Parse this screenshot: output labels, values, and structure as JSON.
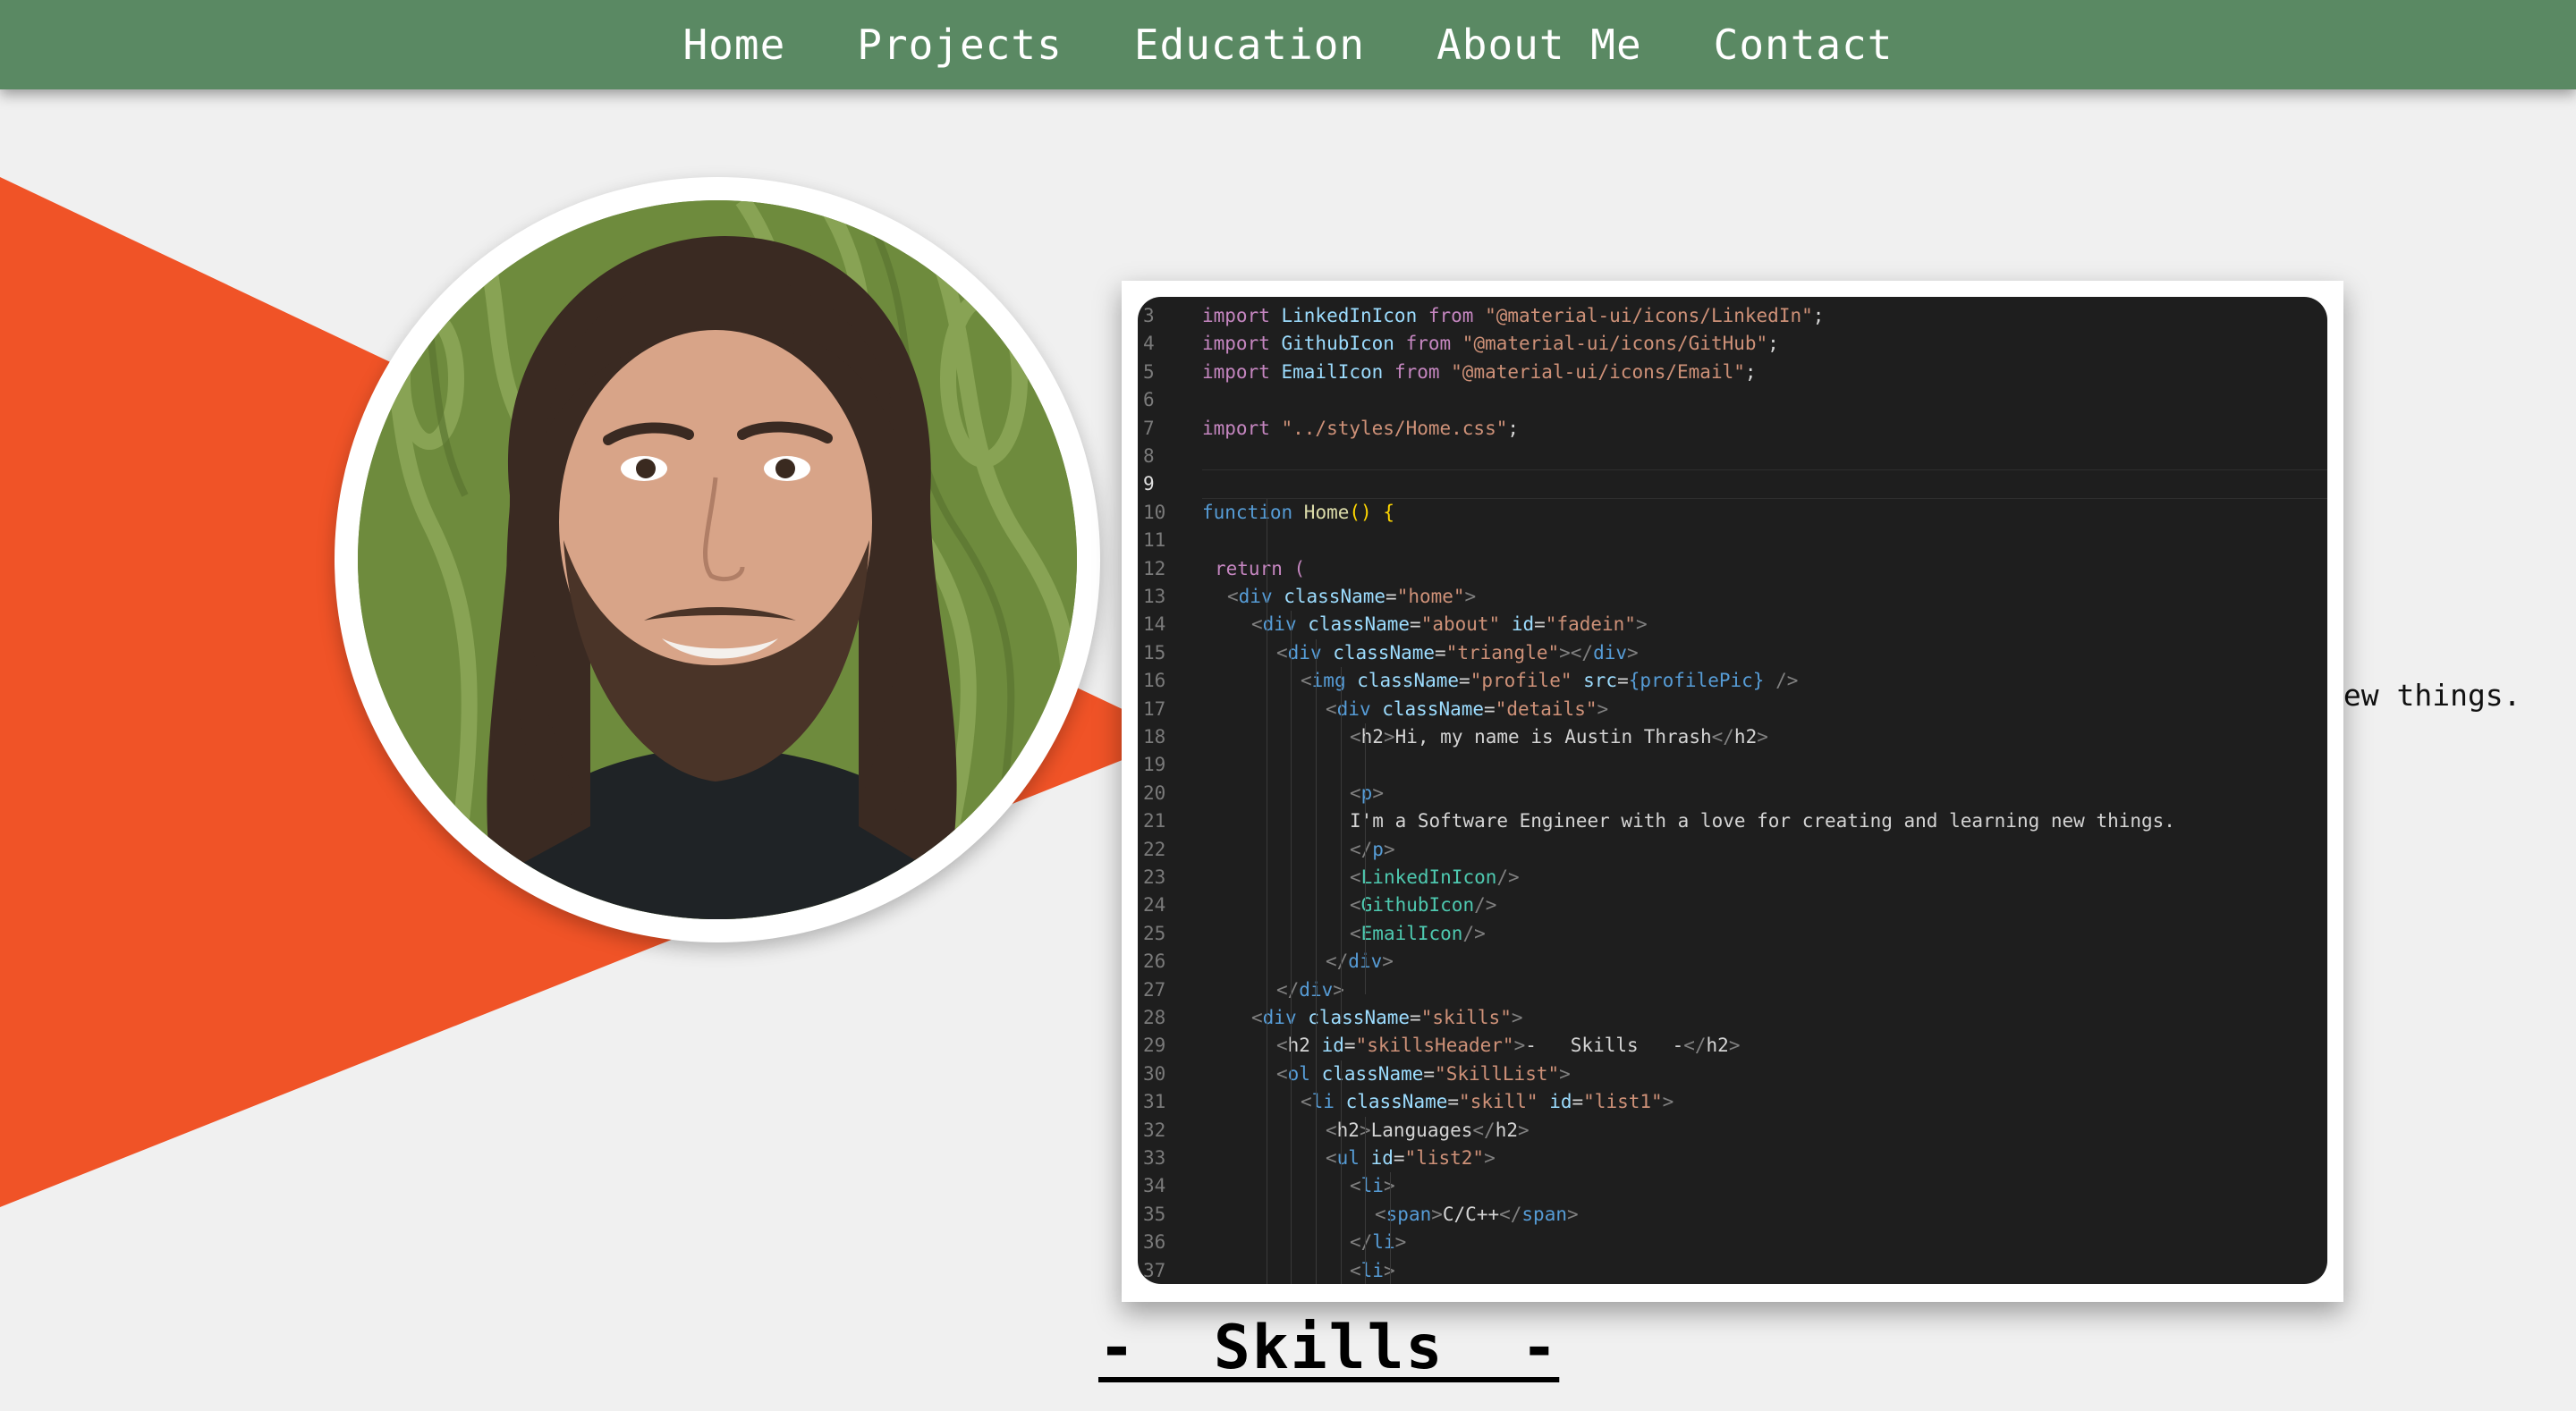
{
  "nav": {
    "items": [
      "Home",
      "Projects",
      "Education",
      "About Me",
      "Contact"
    ]
  },
  "colors": {
    "navbar": "#5a8963",
    "triangle": "#f05327",
    "background": "#f0f0f0",
    "editor": "#1e1e1e"
  },
  "profile": {
    "image_label": "profile-photo"
  },
  "side_text": "new things.",
  "code": {
    "lines": [
      {
        "n": "3"
      },
      {
        "n": "4"
      },
      {
        "n": "5"
      },
      {
        "n": "6"
      },
      {
        "n": "7"
      },
      {
        "n": "8"
      },
      {
        "n": "9"
      },
      {
        "n": "10"
      },
      {
        "n": "11"
      },
      {
        "n": "12"
      },
      {
        "n": "13"
      },
      {
        "n": "14"
      },
      {
        "n": "15"
      },
      {
        "n": "16"
      },
      {
        "n": "17"
      },
      {
        "n": "18"
      },
      {
        "n": "19"
      },
      {
        "n": "20"
      },
      {
        "n": "21"
      },
      {
        "n": "22"
      },
      {
        "n": "23"
      },
      {
        "n": "24"
      },
      {
        "n": "25"
      },
      {
        "n": "26"
      },
      {
        "n": "27"
      },
      {
        "n": "28"
      },
      {
        "n": "29"
      },
      {
        "n": "30"
      },
      {
        "n": "31"
      },
      {
        "n": "32"
      },
      {
        "n": "33"
      },
      {
        "n": "34"
      },
      {
        "n": "35"
      },
      {
        "n": "36"
      },
      {
        "n": "37"
      }
    ],
    "tokens": {
      "l3": [
        "import",
        " LinkedInIcon ",
        "from",
        " \"@material-ui/icons/LinkedIn\"",
        ";"
      ],
      "l4": [
        "import",
        " GithubIcon ",
        "from",
        " \"@material-ui/icons/GitHub\"",
        ";"
      ],
      "l5": [
        "import",
        " EmailIcon ",
        "from",
        " \"@material-ui/icons/Email\"",
        ";"
      ],
      "l7": [
        "import",
        " \"../styles/Home.css\"",
        ";"
      ],
      "l10": [
        "function",
        " Home",
        "()",
        " {"
      ],
      "l12": [
        "return",
        " ("
      ],
      "l13": [
        "<",
        "div",
        " className",
        "=",
        "\"home\"",
        ">"
      ],
      "l14": [
        "<",
        "div",
        " className",
        "=",
        "\"about\"",
        " id",
        "=",
        "\"fadein\"",
        ">"
      ],
      "l15": [
        "<",
        "div",
        " className",
        "=",
        "\"triangle\"",
        "></",
        "div",
        ">"
      ],
      "l16": [
        "<",
        "img",
        " className",
        "=",
        "\"profile\"",
        " src",
        "=",
        "{profilePic}",
        " />"
      ],
      "l17": [
        "<",
        "div",
        " className",
        "=",
        "\"details\"",
        ">"
      ],
      "l18": [
        "<",
        "h2",
        ">",
        "Hi, my name is Austin Thrash",
        "</",
        "h2",
        ">"
      ],
      "l20": [
        "<",
        "p",
        ">"
      ],
      "l21": [
        "I'm a Software Engineer with a love for creating and learning new things."
      ],
      "l22": [
        "</",
        "p",
        ">"
      ],
      "l23": [
        "<",
        "LinkedInIcon",
        "/>"
      ],
      "l24": [
        "<",
        "GithubIcon",
        "/>"
      ],
      "l25": [
        "<",
        "EmailIcon",
        "/>"
      ],
      "l26": [
        "</",
        "div",
        ">"
      ],
      "l27": [
        "</",
        "div",
        ">"
      ],
      "l28": [
        "<",
        "div",
        " className",
        "=",
        "\"skills\"",
        ">"
      ],
      "l29": [
        "<",
        "h2",
        " id",
        "=",
        "\"skillsHeader\"",
        ">",
        "-   Skills   -",
        "</",
        "h2",
        ">"
      ],
      "l30": [
        "<",
        "ol",
        " className",
        "=",
        "\"SkillList\"",
        ">"
      ],
      "l31": [
        "<",
        "li",
        " className",
        "=",
        "\"skill\"",
        " id",
        "=",
        "\"list1\"",
        ">"
      ],
      "l32": [
        "<",
        "h2",
        ">",
        "Languages",
        "</",
        "h2",
        ">"
      ],
      "l33": [
        "<",
        "ul",
        " id",
        "=",
        "\"list2\"",
        ">"
      ],
      "l34": [
        "<",
        "li",
        ">"
      ],
      "l35": [
        "<",
        "span",
        ">",
        "C/C++",
        "</",
        "span",
        ">"
      ],
      "l36": [
        "</",
        "li",
        ">"
      ],
      "l37": [
        "<",
        "li",
        ">"
      ]
    }
  },
  "skills_header": "-  Skills  -"
}
